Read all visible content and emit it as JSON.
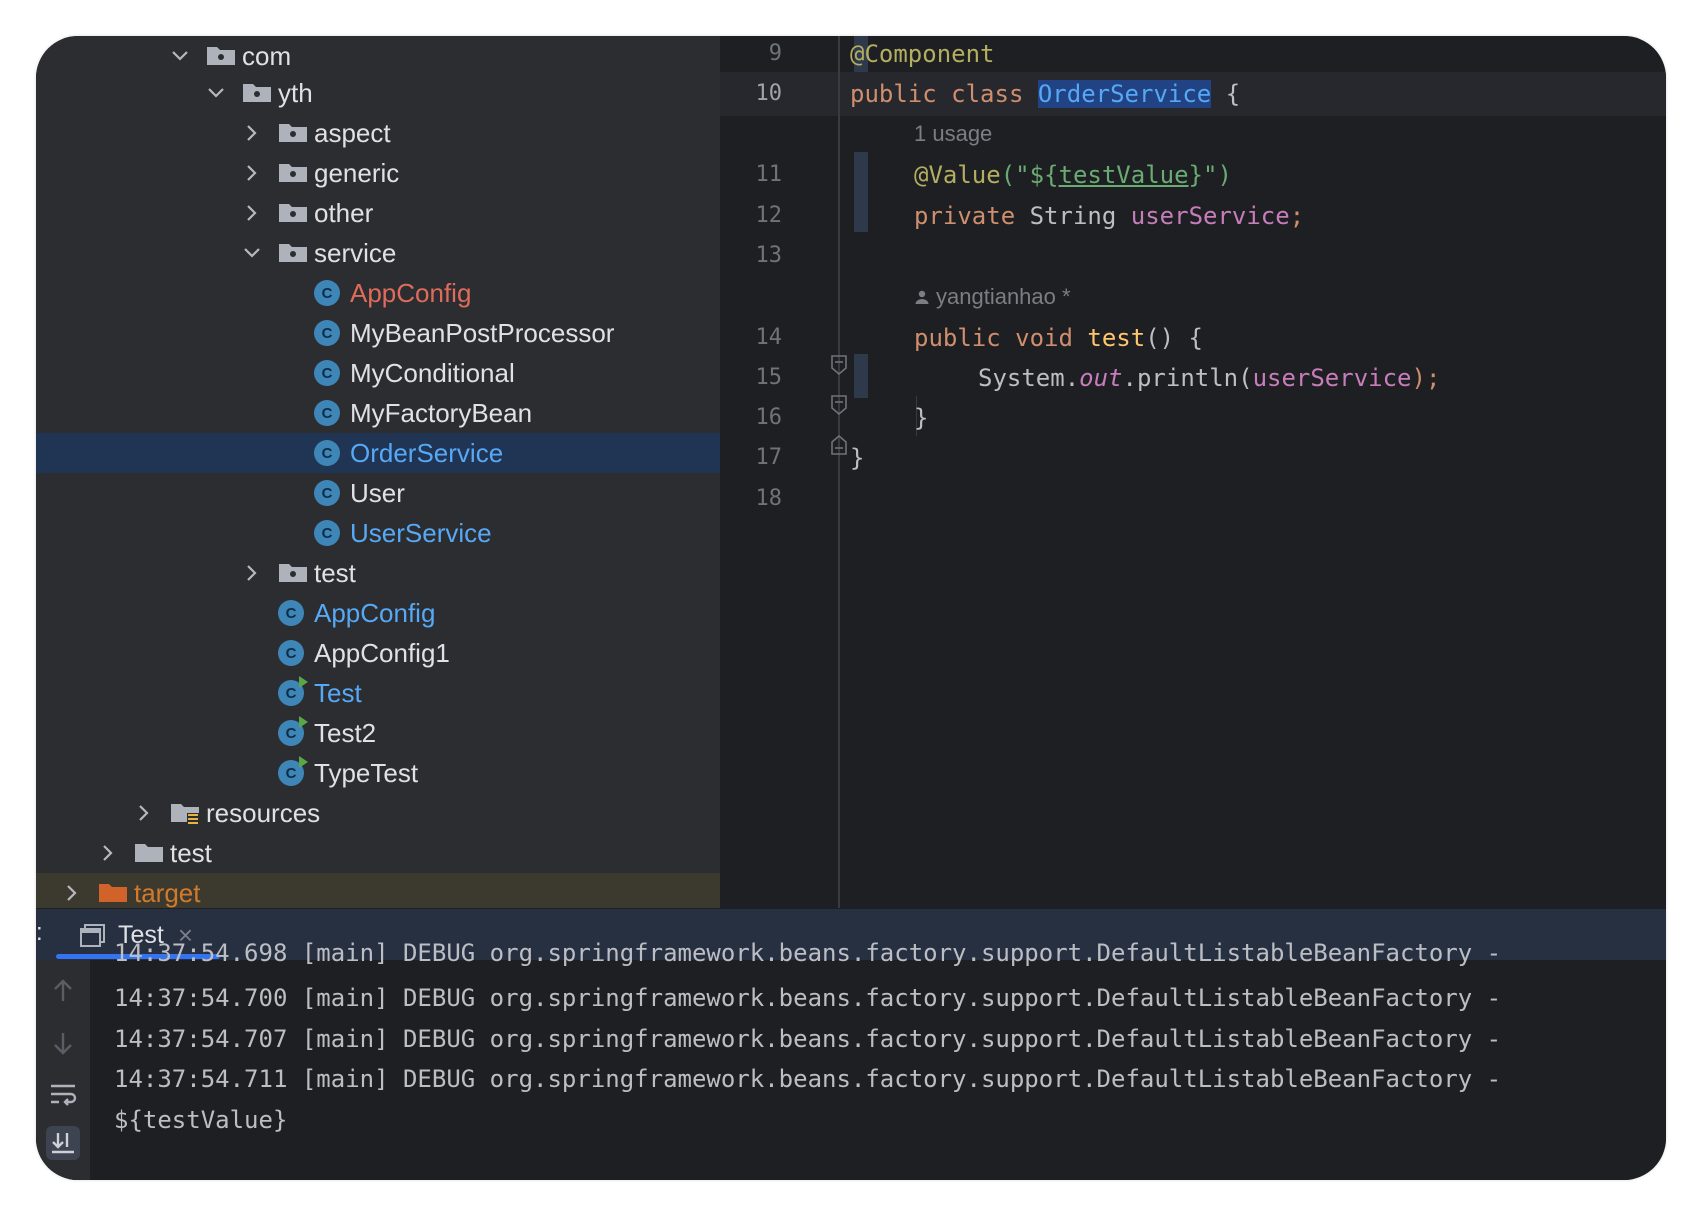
{
  "tree": {
    "items": [
      {
        "label": "com",
        "kind": "package",
        "expanded": true,
        "color": "normal"
      },
      {
        "label": "yth",
        "kind": "package",
        "expanded": true,
        "color": "normal"
      },
      {
        "label": "aspect",
        "kind": "package",
        "expanded": false,
        "color": "normal"
      },
      {
        "label": "generic",
        "kind": "package",
        "expanded": false,
        "color": "normal"
      },
      {
        "label": "other",
        "kind": "package",
        "expanded": false,
        "color": "normal"
      },
      {
        "label": "service",
        "kind": "package",
        "expanded": true,
        "color": "normal"
      },
      {
        "label": "AppConfig",
        "kind": "class",
        "color": "red"
      },
      {
        "label": "MyBeanPostProcessor",
        "kind": "class",
        "color": "normal"
      },
      {
        "label": "MyConditional",
        "kind": "class",
        "color": "normal"
      },
      {
        "label": "MyFactoryBean",
        "kind": "class",
        "color": "normal"
      },
      {
        "label": "OrderService",
        "kind": "class",
        "color": "blue",
        "selected": true
      },
      {
        "label": "User",
        "kind": "class",
        "color": "normal"
      },
      {
        "label": "UserService",
        "kind": "class",
        "color": "blue"
      },
      {
        "label": "test",
        "kind": "package",
        "expanded": false,
        "color": "normal"
      },
      {
        "label": "AppConfig",
        "kind": "class",
        "color": "blue"
      },
      {
        "label": "AppConfig1",
        "kind": "class",
        "color": "normal"
      },
      {
        "label": "Test",
        "kind": "runnable-class",
        "color": "blue"
      },
      {
        "label": "Test2",
        "kind": "runnable-class",
        "color": "normal"
      },
      {
        "label": "TypeTest",
        "kind": "runnable-class",
        "color": "normal"
      },
      {
        "label": "resources",
        "kind": "resources-folder",
        "expanded": false,
        "color": "normal"
      },
      {
        "label": "test",
        "kind": "folder",
        "expanded": false,
        "color": "normal"
      },
      {
        "label": "target",
        "kind": "excluded-folder",
        "expanded": false,
        "color": "orange"
      }
    ],
    "class_icon_letter": "C"
  },
  "editor": {
    "line_numbers": [
      "9",
      "10",
      "11",
      "12",
      "13",
      "14",
      "15",
      "16",
      "17",
      "18"
    ],
    "usage_hint": "1 usage",
    "author_hint": "yangtianhao *",
    "code": {
      "l9_annotation": "@Component",
      "l10_kw1": "public",
      "l10_kw2": "class",
      "l10_name": "OrderService",
      "l10_brace": "{",
      "l11_annotation": "@Value",
      "l11_open": "(\"${",
      "l11_key": "testValue",
      "l11_close": "}\")",
      "l12_kw": "private",
      "l12_type": "String",
      "l12_field": "userService",
      "l12_semi": ";",
      "l14_kw1": "public",
      "l14_kw2": "void",
      "l14_name": "test",
      "l14_rest": "() {",
      "l15_sys": "System.",
      "l15_out": "out",
      "l15_println": ".println(",
      "l15_arg": "userService",
      "l15_close": ");",
      "l16_brace": "}",
      "l17_brace": "}"
    }
  },
  "run_window": {
    "tab_label": "Test",
    "close_glyph": "×",
    "left_edge_glyph": ":",
    "console_lines": [
      "14:37:54.698 [main] DEBUG org.springframework.beans.factory.support.DefaultListableBeanFactory -",
      "14:37:54.700 [main] DEBUG org.springframework.beans.factory.support.DefaultListableBeanFactory -",
      "14:37:54.707 [main] DEBUG org.springframework.beans.factory.support.DefaultListableBeanFactory -",
      "14:37:54.711 [main] DEBUG org.springframework.beans.factory.support.DefaultListableBeanFactory -",
      "${testValue}"
    ],
    "side_icons": [
      "arrow-up-icon",
      "arrow-down-icon",
      "soft-wrap-icon",
      "scroll-to-end-icon"
    ]
  },
  "colors": {
    "background": "#2b2d30",
    "editor_bg": "#1e1f22",
    "selection": "#1f3553",
    "class_icon": "#3f86b8",
    "accent": "#3574f0"
  }
}
